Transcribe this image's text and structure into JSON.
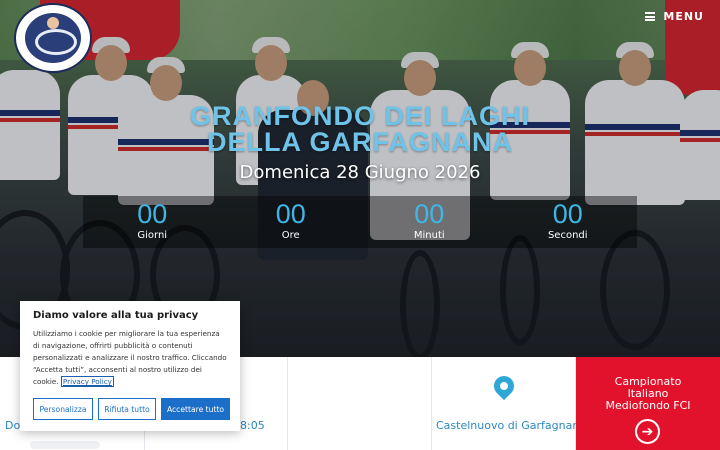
{
  "header": {
    "logo_name": "granfondo-logo",
    "menu_label": "MENU"
  },
  "hero": {
    "title_line1": "GRANFONDO DEI LAGHI",
    "title_line2": "DELLA GARFAGNANA",
    "date": "Domenica 28 Giugno 2026",
    "countdown": [
      {
        "value": "00",
        "label": "Giorni"
      },
      {
        "value": "00",
        "label": "Ore"
      },
      {
        "value": "00",
        "label": "Minuti"
      },
      {
        "value": "00",
        "label": "Secondi"
      }
    ]
  },
  "info": {
    "cell1_text": "Do",
    "cell2_text": "8:05",
    "location": "Castelnuovo di Garfagnana",
    "championship_line1": "Campionato",
    "championship_line2": "Italiano",
    "championship_line3": "Mediofondo FCI"
  },
  "cookie": {
    "title": "Diamo valore alla tua privacy",
    "body": "Utilizziamo i cookie per migliorare la tua esperienza di navigazione, offrirti pubblicità o contenuti personalizzati e analizzare il nostro traffico. Cliccando “Accetta tutti”, acconsenti al nostro utilizzo dei cookie.",
    "policy_link": "Privacy Policy",
    "btn_customize": "Personalizza",
    "btn_reject": "Rifiuta tutto",
    "btn_accept": "Accettare tutto"
  },
  "colors": {
    "accent_red": "#e3122c",
    "title_blue": "#6fc3e8",
    "link_blue": "#1c6fc8"
  },
  "icons": {
    "menu": "hamburger-icon",
    "location": "map-pin-icon",
    "arrow": "arrow-right-circle-icon"
  }
}
